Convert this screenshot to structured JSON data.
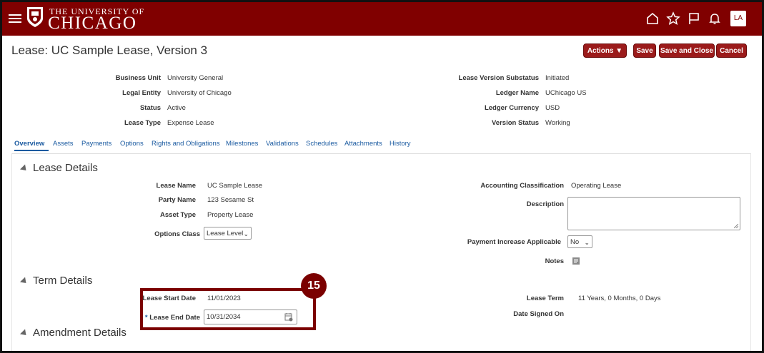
{
  "header": {
    "university_small": "THE UNIVERSITY OF",
    "university_big": "CHICAGO",
    "avatar_initials": "LA",
    "brand_color": "#800000"
  },
  "page": {
    "title": "Lease: UC Sample Lease, Version 3",
    "actions_label": "Actions",
    "save_label": "Save",
    "save_close_label": "Save and Close",
    "cancel_label": "Cancel"
  },
  "summary": {
    "business_unit_label": "Business Unit",
    "business_unit": "University General",
    "legal_entity_label": "Legal Entity",
    "legal_entity": "University of Chicago",
    "status_label": "Status",
    "status": "Active",
    "lease_type_label": "Lease Type",
    "lease_type": "Expense Lease",
    "substatus_label": "Lease Version Substatus",
    "substatus": "Initiated",
    "ledger_name_label": "Ledger Name",
    "ledger_name": "UChicago US",
    "ledger_currency_label": "Ledger Currency",
    "ledger_currency": "USD",
    "version_status_label": "Version Status",
    "version_status": "Working"
  },
  "tabs": [
    "Overview",
    "Assets",
    "Payments",
    "Options",
    "Rights and Obligations",
    "Milestones",
    "Validations",
    "Schedules",
    "Attachments",
    "History"
  ],
  "lease_details": {
    "heading": "Lease Details",
    "lease_name_label": "Lease Name",
    "lease_name": "UC Sample Lease",
    "party_name_label": "Party Name",
    "party_name": "123 Sesame St",
    "asset_type_label": "Asset Type",
    "asset_type": "Property Lease",
    "options_class_label": "Options Class",
    "options_class": "Lease Level",
    "accounting_class_label": "Accounting Classification",
    "accounting_class": "Operating Lease",
    "description_label": "Description",
    "payment_increase_label": "Payment Increase Applicable",
    "payment_increase": "No",
    "notes_label": "Notes"
  },
  "term_details": {
    "heading": "Term Details",
    "start_date_label": "Lease Start Date",
    "start_date": "11/01/2023",
    "end_date_required": "*",
    "end_date_label": "Lease End Date",
    "end_date": "10/31/2034",
    "lease_term_label": "Lease Term",
    "lease_term": "11 Years, 0 Months, 0 Days",
    "date_signed_label": "Date Signed On"
  },
  "amendment_details": {
    "heading": "Amendment Details"
  },
  "callout": {
    "step_number": "15"
  }
}
